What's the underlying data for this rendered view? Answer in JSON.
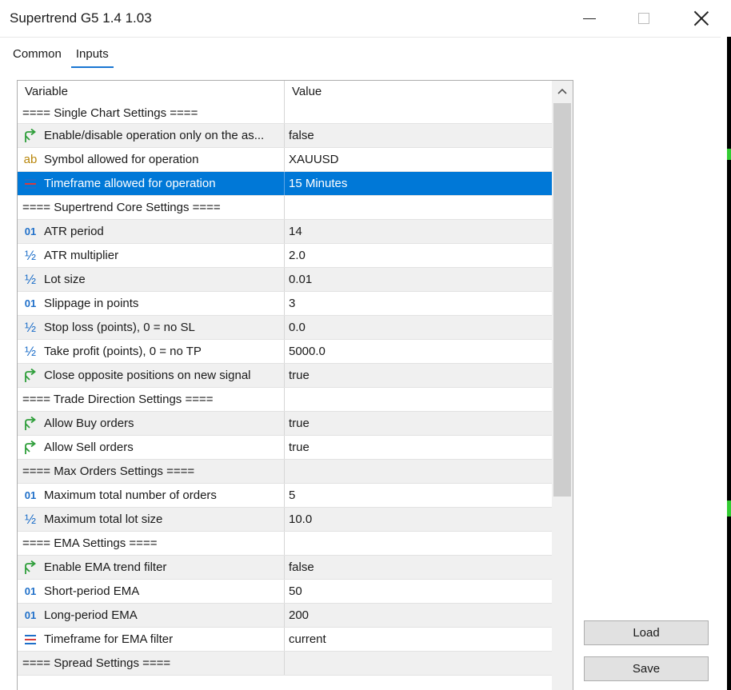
{
  "window": {
    "title": "Supertrend G5 1.4 1.03"
  },
  "tabs": [
    {
      "label": "Common",
      "active": false
    },
    {
      "label": "Inputs",
      "active": true
    }
  ],
  "grid": {
    "columns": {
      "variable": "Variable",
      "value": "Value"
    },
    "rows": [
      {
        "type": "section",
        "variable": "==== Single Chart Settings ====",
        "value": ""
      },
      {
        "type": "bool",
        "icon": "bool-arrow-icon",
        "variable": "Enable/disable operation only on the as...",
        "value": "false"
      },
      {
        "type": "string",
        "icon": "string-ab-icon",
        "variable": "Symbol allowed for operation",
        "value": "XAUUSD"
      },
      {
        "type": "enum",
        "icon": "enum-list-icon",
        "variable": "Timeframe allowed for operation",
        "value": "15 Minutes",
        "selected": true
      },
      {
        "type": "section",
        "variable": "==== Supertrend Core Settings ====",
        "value": ""
      },
      {
        "type": "int",
        "icon": "integer-01-icon",
        "variable": "ATR period",
        "value": "14"
      },
      {
        "type": "double",
        "icon": "double-half-icon",
        "variable": "ATR multiplier",
        "value": "2.0"
      },
      {
        "type": "double",
        "icon": "double-half-icon",
        "variable": "Lot size",
        "value": "0.01"
      },
      {
        "type": "int",
        "icon": "integer-01-icon",
        "variable": "Slippage in points",
        "value": "3"
      },
      {
        "type": "double",
        "icon": "double-half-icon",
        "variable": "Stop loss (points), 0 = no SL",
        "value": "0.0"
      },
      {
        "type": "double",
        "icon": "double-half-icon",
        "variable": "Take profit (points), 0 = no TP",
        "value": "5000.0"
      },
      {
        "type": "bool",
        "icon": "bool-arrow-icon",
        "variable": "Close opposite positions on new signal",
        "value": "true"
      },
      {
        "type": "section",
        "variable": "==== Trade Direction Settings ====",
        "value": ""
      },
      {
        "type": "bool",
        "icon": "bool-arrow-icon",
        "variable": "Allow Buy orders",
        "value": "true"
      },
      {
        "type": "bool",
        "icon": "bool-arrow-icon",
        "variable": "Allow Sell orders",
        "value": "true"
      },
      {
        "type": "section",
        "variable": "==== Max Orders Settings ====",
        "value": ""
      },
      {
        "type": "int",
        "icon": "integer-01-icon",
        "variable": "Maximum total number of orders",
        "value": "5"
      },
      {
        "type": "double",
        "icon": "double-half-icon",
        "variable": "Maximum total lot size",
        "value": "10.0"
      },
      {
        "type": "section",
        "variable": "==== EMA Settings ====",
        "value": ""
      },
      {
        "type": "bool",
        "icon": "bool-arrow-icon",
        "variable": "Enable EMA trend filter",
        "value": "false"
      },
      {
        "type": "int",
        "icon": "integer-01-icon",
        "variable": "Short-period EMA",
        "value": "50"
      },
      {
        "type": "int",
        "icon": "integer-01-icon",
        "variable": "Long-period EMA",
        "value": "200"
      },
      {
        "type": "enum",
        "icon": "enum-list-icon",
        "variable": "Timeframe for EMA filter",
        "value": "current"
      },
      {
        "type": "section",
        "variable": "==== Spread Settings ====",
        "value": ""
      }
    ]
  },
  "buttons": {
    "load": "Load",
    "save": "Save"
  },
  "colors": {
    "selection": "#0078d7",
    "tab_underline": "#1976d2",
    "row_alt": "#f0f0f0",
    "bool_icon": "#2e9e3a",
    "int_icon": "#1e6fc9",
    "string_icon": "#b8860b",
    "enum_icon_red": "#d83b3b"
  }
}
